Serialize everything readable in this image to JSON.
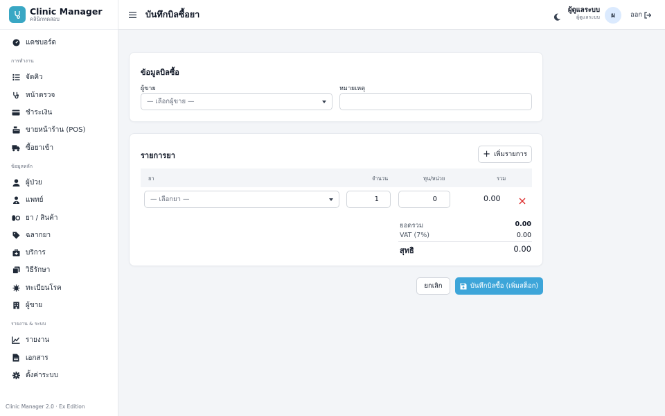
{
  "brand": {
    "title": "Clinic Manager",
    "subtitle": "คลินิกทดสอบ"
  },
  "sidebar": {
    "sections": [
      {
        "title": "",
        "items": [
          {
            "label": "แดชบอร์ด",
            "icon": "dashboard-icon"
          }
        ]
      },
      {
        "title": "การทำงาน",
        "items": [
          {
            "label": "จัดคิว",
            "icon": "list-ordered-icon"
          },
          {
            "label": "หน้าตรวจ",
            "icon": "stethoscope-icon"
          },
          {
            "label": "ชำระเงิน",
            "icon": "credit-card-icon"
          },
          {
            "label": "ขายหน้าร้าน (POS)",
            "icon": "cash-register-icon"
          },
          {
            "label": "ซื้อยาเข้า",
            "icon": "truck-icon"
          }
        ]
      },
      {
        "title": "ข้อมูลหลัก",
        "items": [
          {
            "label": "ผู้ป่วย",
            "icon": "user-icon"
          },
          {
            "label": "แพทย์",
            "icon": "doctor-icon"
          },
          {
            "label": "ยา / สินค้า",
            "icon": "pills-icon"
          },
          {
            "label": "ฉลากยา",
            "icon": "tag-icon"
          },
          {
            "label": "บริการ",
            "icon": "medkit-icon"
          },
          {
            "label": "วิธีรักษา",
            "icon": "layers-icon"
          },
          {
            "label": "ทะเบียนโรค",
            "icon": "virus-icon"
          },
          {
            "label": "ผู้ขาย",
            "icon": "building-icon"
          }
        ]
      },
      {
        "title": "รายงาน & ระบบ",
        "items": [
          {
            "label": "รายงาน",
            "icon": "chart-icon"
          },
          {
            "label": "เอกสาร",
            "icon": "document-icon"
          },
          {
            "label": "ตั้งค่าระบบ",
            "icon": "gear-icon"
          }
        ]
      }
    ],
    "footer": "Clinic Manager 2.0 · Ex Edition"
  },
  "header": {
    "title": "บันทึกบิลซื้อยา",
    "user_name": "ผู้ดูแลระบบ",
    "user_role": "ผู้ดูแลระบบ",
    "avatar_initial": "ผ",
    "logout_label": "ออก"
  },
  "bill_info": {
    "title": "ข้อมูลบิลซื้อ",
    "vendor_label": "ผู้ขาย",
    "vendor_placeholder": "— เลือกผู้ขาย —",
    "note_label": "หมายเหตุ",
    "note_value": ""
  },
  "items": {
    "title": "รายการยา",
    "add_label": "เพิ่มรายการ",
    "columns": {
      "drug": "ยา",
      "qty": "จำนวน",
      "cost": "ทุน/หน่วย",
      "total": "รวม"
    },
    "rows": [
      {
        "drug_placeholder": "— เลือกยา —",
        "qty": "1",
        "cost": "0",
        "total": "0.00"
      }
    ]
  },
  "summary": {
    "subtotal_label": "ยอดรวม",
    "subtotal_value": "0.00",
    "vat_label": "VAT (7%)",
    "vat_value": "0.00",
    "net_label": "สุทธิ",
    "net_value": "0.00"
  },
  "actions": {
    "cancel_label": "ยกเลิก",
    "save_label": "บันทึกบิลซื้อ (เพิ่มสต็อก)"
  },
  "colors": {
    "accent": "#3da5d9",
    "brand": "#39a7c4",
    "danger": "#dc2626"
  }
}
